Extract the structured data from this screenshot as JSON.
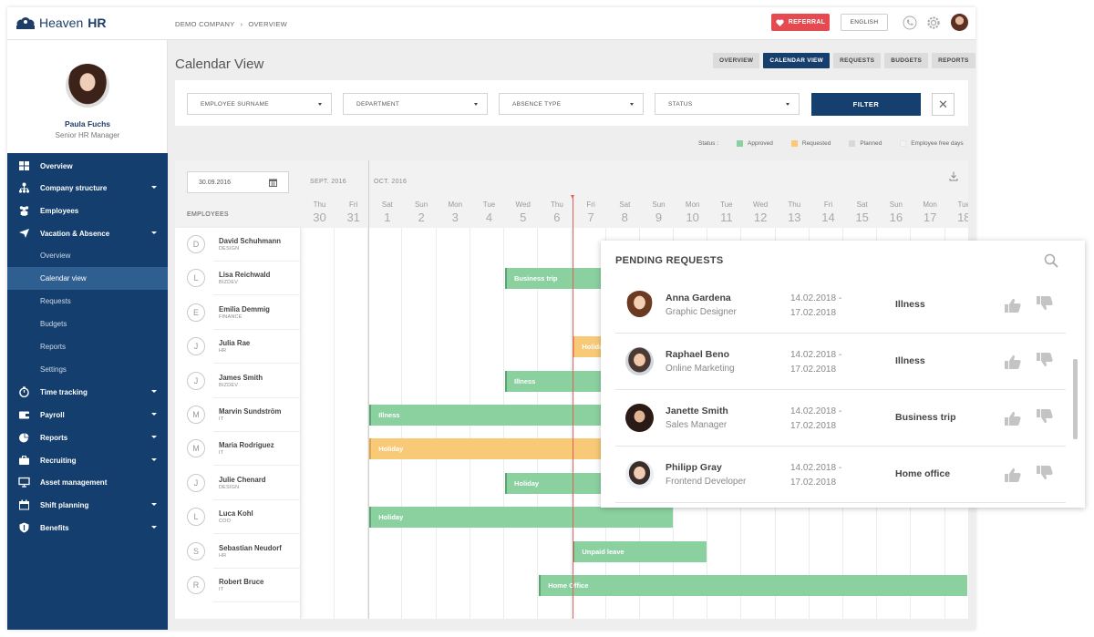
{
  "header": {
    "logo_prefix": "Heaven",
    "logo_suffix": "HR",
    "breadcrumb": [
      "DEMO COMPANY",
      "›",
      "OVERVIEW"
    ],
    "referral_label": "REFERRAL",
    "language": "ENGLISH"
  },
  "profile": {
    "name": "Paula Fuchs",
    "role": "Senior HR Manager"
  },
  "nav": {
    "items": [
      {
        "label": "Overview",
        "icon": "grid-icon"
      },
      {
        "label": "Company structure",
        "icon": "org-chart-icon"
      },
      {
        "label": "Employees",
        "icon": "people-icon"
      },
      {
        "label": "Vacation & Absence",
        "icon": "plane-icon"
      },
      {
        "label": "Time tracking",
        "icon": "stopwatch-icon"
      },
      {
        "label": "Payroll",
        "icon": "wallet-icon"
      },
      {
        "label": "Reports",
        "icon": "pie-chart-icon"
      },
      {
        "label": "Recruiting",
        "icon": "briefcase-icon"
      },
      {
        "label": "Asset management",
        "icon": "monitor-icon"
      },
      {
        "label": "Shift planning",
        "icon": "calendar-icon"
      },
      {
        "label": "Benefits",
        "icon": "shield-icon"
      }
    ],
    "sub_items": [
      "Overview",
      "Calendar view",
      "Requests",
      "Budgets",
      "Reports",
      "Settings"
    ],
    "active_sub": "Calendar view"
  },
  "page": {
    "title": "Calendar View",
    "tabs": [
      "OVERVIEW",
      "CALENDAR VIEW",
      "REQUESTS",
      "BUDGETS",
      "REPORTS"
    ],
    "active_tab": "CALENDAR VIEW"
  },
  "filters": {
    "selects": [
      "EMPLOYEE SURNAME",
      "DEPARTMENT",
      "ABSENCE TYPE",
      "STATUS"
    ],
    "filter_label": "FILTER",
    "clear_label": "✕"
  },
  "legend": {
    "label": "Status :",
    "items": [
      {
        "label": "Approved",
        "color": "#8bd1a0"
      },
      {
        "label": "Requested",
        "color": "#f8c976"
      },
      {
        "label": "Planned",
        "color": "#d8d8d8"
      },
      {
        "label": "Employee free days",
        "color": "#f4f4f4"
      }
    ]
  },
  "calendar": {
    "date": "30.09.2016",
    "employees_header": "EMPLOYEES",
    "months": [
      "SEPT. 2016",
      "OCT. 2016"
    ],
    "days": [
      {
        "name": "Thu",
        "num": "30"
      },
      {
        "name": "Fri",
        "num": "31"
      },
      {
        "name": "Sat",
        "num": "1"
      },
      {
        "name": "Sun",
        "num": "2"
      },
      {
        "name": "Mon",
        "num": "3"
      },
      {
        "name": "Tue",
        "num": "4"
      },
      {
        "name": "Wed",
        "num": "5"
      },
      {
        "name": "Thu",
        "num": "6"
      },
      {
        "name": "Fri",
        "num": "7"
      },
      {
        "name": "Sat",
        "num": "8"
      },
      {
        "name": "Sun",
        "num": "9"
      },
      {
        "name": "Mon",
        "num": "10"
      },
      {
        "name": "Tue",
        "num": "11"
      },
      {
        "name": "Wed",
        "num": "12"
      },
      {
        "name": "Thu",
        "num": "13"
      },
      {
        "name": "Fri",
        "num": "14"
      },
      {
        "name": "Sat",
        "num": "15"
      },
      {
        "name": "Sun",
        "num": "16"
      },
      {
        "name": "Mon",
        "num": "17"
      },
      {
        "name": "Tue",
        "num": "18"
      }
    ],
    "employees": [
      {
        "initial": "D",
        "name": "David Schuhmann",
        "dept": "DESIGN"
      },
      {
        "initial": "L",
        "name": "Lisa Reichwald",
        "dept": "BIZDEV"
      },
      {
        "initial": "E",
        "name": "Emilia Demmig",
        "dept": "FINANCE"
      },
      {
        "initial": "J",
        "name": "Julia Rae",
        "dept": "HR"
      },
      {
        "initial": "J",
        "name": "James Smith",
        "dept": "BIZDEV"
      },
      {
        "initial": "M",
        "name": "Marvin Sundström",
        "dept": "IT"
      },
      {
        "initial": "M",
        "name": "Maria Rodriguez",
        "dept": "IT"
      },
      {
        "initial": "J",
        "name": "Julie Chenard",
        "dept": "DESIGN"
      },
      {
        "initial": "L",
        "name": "Luca Kohl",
        "dept": "COO"
      },
      {
        "initial": "S",
        "name": "Sebastian Neudorf",
        "dept": "HR"
      },
      {
        "initial": "R",
        "name": "Robert Bruce",
        "dept": "IT"
      }
    ],
    "bars": [
      {
        "row": 1,
        "label": "Business trip",
        "status": "approved",
        "start": "4",
        "end": "7"
      },
      {
        "row": 3,
        "label": "Holiday",
        "status": "requested",
        "start": "6",
        "end": "7"
      },
      {
        "row": 4,
        "label": "Illness",
        "status": "approved",
        "start": "4",
        "end": "7"
      },
      {
        "row": 5,
        "label": "Illness",
        "status": "approved",
        "start": "31",
        "end": "7"
      },
      {
        "row": 6,
        "label": "Holiday",
        "status": "requested",
        "start": "31",
        "end": "7"
      },
      {
        "row": 7,
        "label": "Holiday",
        "status": "approved",
        "start": "4",
        "end": "7"
      },
      {
        "row": 8,
        "label": "Holiday",
        "status": "approved",
        "start": "31",
        "end": "8"
      },
      {
        "row": 9,
        "label": "Unpaid leave",
        "status": "approved",
        "start": "6",
        "end": "9"
      },
      {
        "row": 10,
        "label": "Home Office",
        "status": "approved",
        "start": "5",
        "end": "18"
      }
    ]
  },
  "pending": {
    "title": "PENDING REQUESTS",
    "requests": [
      {
        "name": "Anna Gardena",
        "role": "Graphic Designer",
        "from": "14.02.2018 -",
        "to": "17.02.2018",
        "type": "Illness"
      },
      {
        "name": "Raphael Beno",
        "role": "Online Marketing",
        "from": "14.02.2018 -",
        "to": "17.02.2018",
        "type": "Illness"
      },
      {
        "name": "Janette Smith",
        "role": "Sales Manager",
        "from": "14.02.2018 -",
        "to": "17.02.2018",
        "type": "Business trip"
      },
      {
        "name": "Philipp Gray",
        "role": "Frontend Developer",
        "from": "14.02.2018 -",
        "to": "17.02.2018",
        "type": "Home office"
      }
    ]
  }
}
